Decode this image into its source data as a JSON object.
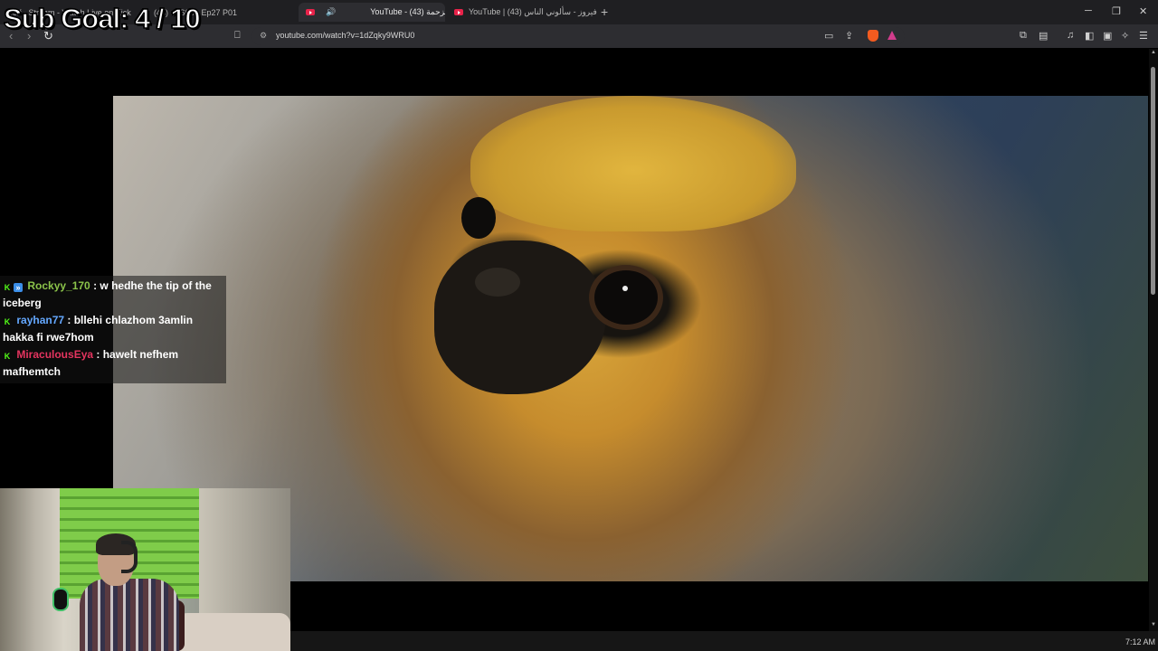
{
  "tabs": [
    {
      "title": "Seif - Stream - Watch Live on Kick",
      "active": false
    },
    {
      "title": "(43) ... S03 - Ep27 P01",
      "active": false
    },
    {
      "title": "YouTube - الزحمة (43)",
      "active": true
    },
    {
      "title": "YouTube | فيروز - سألوني الناس (43)",
      "active": false
    }
  ],
  "address_bar": {
    "url": "youtube.com/watch?v=1dZqky9WRU0"
  },
  "overlay": {
    "sub_goal": "Sub Goal:  4 / 10"
  },
  "chat": [
    {
      "user": "Rockyy_170",
      "user_color": "#8bc34a",
      "text": ": w hedhe the tip of the iceberg",
      "badges": [
        "kick",
        "blue"
      ]
    },
    {
      "user": "rayhan77",
      "user_color": "#64a8ff",
      "text": ": bllehi chlazhom 3amlin hakka fi rwe7hom",
      "badges": [
        "kick"
      ]
    },
    {
      "user": "MiraculousEya",
      "user_color": "#e4345f",
      "text": ": hawelt nefhem mafhemtch",
      "badges": [
        "kick"
      ]
    }
  ],
  "taskbar": {
    "clock": "7:12 AM"
  },
  "icons": {
    "back": "arrow-left-icon",
    "forward": "arrow-right-icon",
    "reload": "reload-icon",
    "bookmark": "bookmark-icon",
    "site_info": "tune-icon",
    "cast": "cast-icon",
    "share": "share-icon",
    "brave": "brave-shield-icon",
    "rewards": "brave-rewards-icon",
    "extensions": "puzzle-icon",
    "media": "music-icon",
    "sidebar": "sidebar-icon",
    "wallet": "wallet-icon",
    "leo": "leo-ai-icon",
    "menu": "hamburger-icon"
  }
}
